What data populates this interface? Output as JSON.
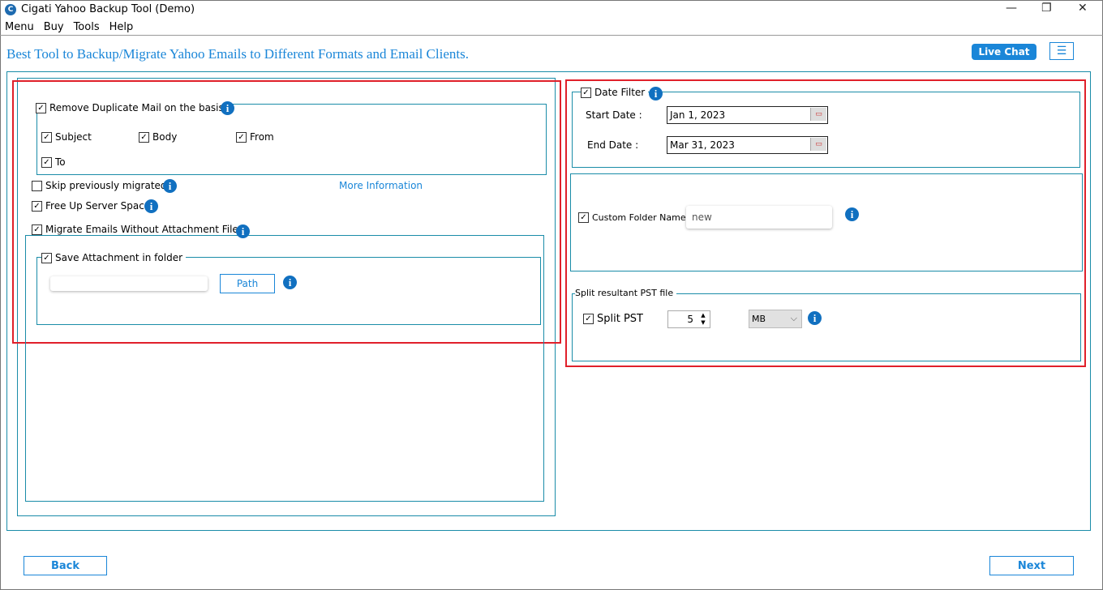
{
  "window": {
    "title": "Cigati Yahoo Backup Tool (Demo)",
    "minimize": "—",
    "maximize": "❐",
    "close": "✕"
  },
  "menu": [
    "Menu",
    "Buy",
    "Tools",
    "Help"
  ],
  "header": {
    "title": "Best Tool to Backup/Migrate Yahoo Emails to Different Formats and Email Clients.",
    "live_chat": "Live Chat"
  },
  "left": {
    "remove_duplicate": {
      "label": "Remove Duplicate Mail on the basis",
      "checked": true,
      "options": [
        {
          "label": "Subject",
          "checked": true
        },
        {
          "label": "Body",
          "checked": true
        },
        {
          "label": "From",
          "checked": true
        },
        {
          "label": "To",
          "checked": true
        }
      ]
    },
    "skip_migrated": {
      "label": "Skip previously migrated",
      "checked": false
    },
    "more_info": "More Information",
    "free_up": {
      "label": "Free Up Server Space",
      "checked": true
    },
    "without_attachment": {
      "label": "Migrate Emails Without Attachment Files",
      "checked": true
    },
    "save_attachment": {
      "label": "Save Attachment in folder",
      "checked": true,
      "path_value": "",
      "path_button": "Path"
    }
  },
  "right": {
    "date_filter": {
      "label": "Date Filter",
      "checked": true,
      "start_label": "Start Date :",
      "start_value": "Jan 1, 2023",
      "end_label": "End Date :",
      "end_value": "Mar 31, 2023"
    },
    "custom_folder": {
      "label": "Custom Folder Name",
      "checked": true,
      "value": "new"
    },
    "split": {
      "group": "Split resultant PST file",
      "label": "Split PST",
      "checked": true,
      "value": "5",
      "unit": "MB"
    }
  },
  "footer": {
    "back": "Back",
    "next": "Next"
  },
  "colors": {
    "accent": "#1a86d8",
    "frame": "#1a8ca8",
    "highlight": "#e0202a"
  }
}
